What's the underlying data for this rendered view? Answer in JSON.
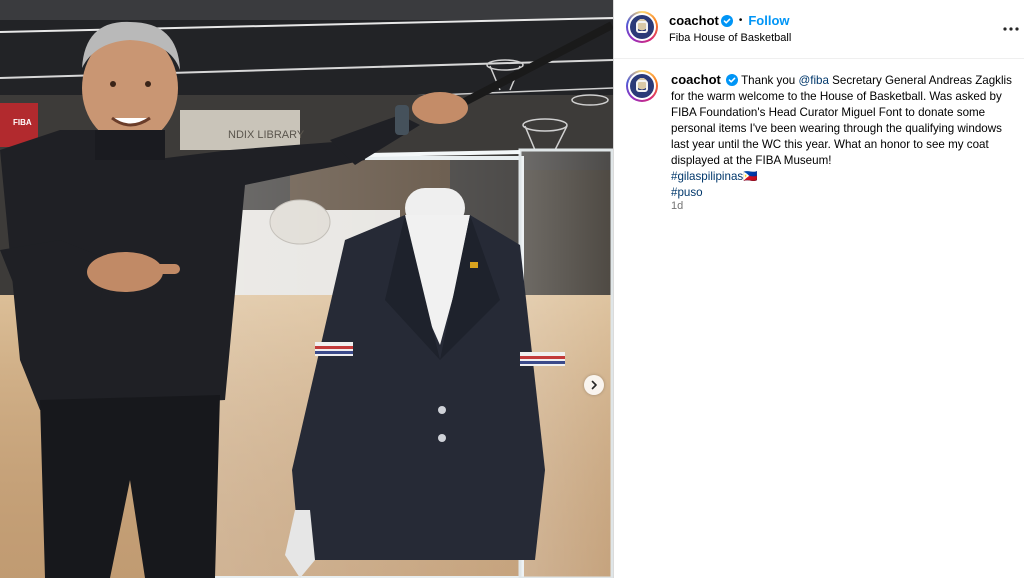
{
  "post": {
    "username": "coachot",
    "verified": true,
    "follow_label": "Follow",
    "separator": "•",
    "location": "Fiba House of Basketball"
  },
  "caption": {
    "username": "coachot",
    "mention": "@fiba",
    "text_before_mention": "Thank you ",
    "text_after_mention": " Secretary General Andreas Zagklis for the warm welcome to the House of Basketball. Was asked by FIBA Foundation's Head Curator Miguel Font to donate some personal items I've been wearing through the qualifying windows last year until the WC this year. What an honor to see my coat displayed at the FIBA Museum!",
    "hashtags": [
      "#gilaspilipinas🇵🇭",
      "#puso"
    ],
    "timestamp": "1d"
  },
  "media": {
    "background_sign": "FIBA",
    "library_sign": "NDIX LIBRARY",
    "icons": [
      "chevron-right-icon"
    ]
  },
  "colors": {
    "link_blue": "#0095f6",
    "mention_blue": "#00376b",
    "verified_blue": "#0095f6"
  }
}
